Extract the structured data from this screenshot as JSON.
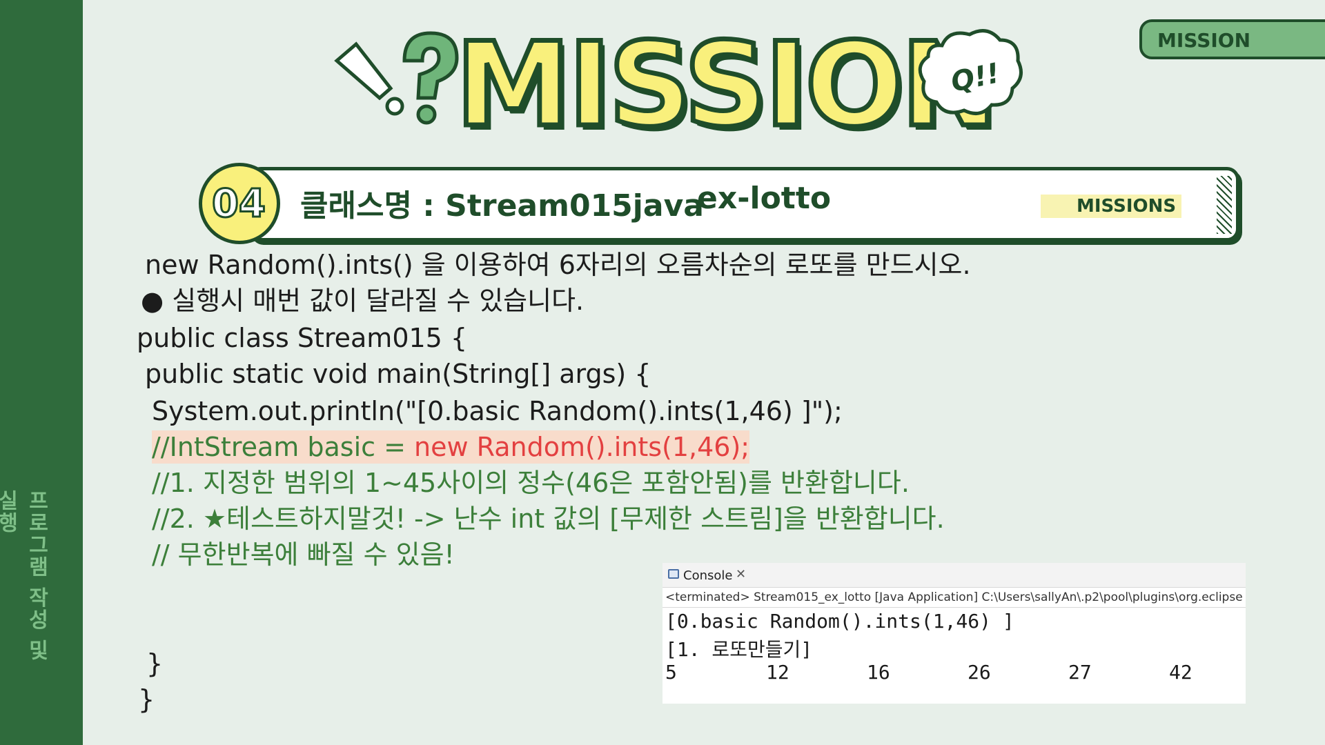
{
  "sidebar": {
    "vertical_text": "프로그램 작성 및 실행"
  },
  "header": {
    "title": "MISSION",
    "bubble_text": "Q!!",
    "tab_label": "MISSION"
  },
  "mission_bar": {
    "number": "04",
    "class_label": "클래스명 : Stream015java",
    "suffix": "ex-lotto",
    "tag": "MISSIONS"
  },
  "content": {
    "instruction": "new Random().ints() 을 이용하여 6자리의 오름차순의 로또를 만드시오.",
    "bullet": "●  실행시 매번 값이 달라질 수 있습니다.",
    "code": {
      "class_decl": "public class Stream015 {",
      "main_decl": "public static void main(String[] args) {",
      "println": "System.out.println(\"[0.basic Random().ints(1,46) ]\");",
      "comment_prefix": "//IntStream basic = ",
      "comment_red": "new Random().ints(1,46);",
      "comment2": "//1. 지정한 범위의 1~45사이의 정수(46은 포함안됨)를 반환합니다.",
      "comment3": "//2. ★테스트하지말것! -> 난수 int 값의 [무제한 스트림]을 반환합니다.",
      "comment4": "// 무한반복에 빠질 수 있음!",
      "close1": "}",
      "close2": "}"
    }
  },
  "console": {
    "tab_label": "Console",
    "close_symbol": "✕",
    "status": "<terminated> Stream015_ex_lotto [Java Application] C:\\Users\\sallyAn\\.p2\\pool\\plugins\\org.eclipse",
    "line1": "[0.basic Random().ints(1,46) ]",
    "line2": "[1. 로또만들기]",
    "numbers": [
      "5",
      "12",
      "16",
      "26",
      "27",
      "42"
    ]
  },
  "colors": {
    "dark_green": "#1f4d2a",
    "sidebar_green": "#2f6b3c",
    "yellow": "#f9f07c",
    "comment_green": "#3c7f3a",
    "red": "#e34040"
  }
}
